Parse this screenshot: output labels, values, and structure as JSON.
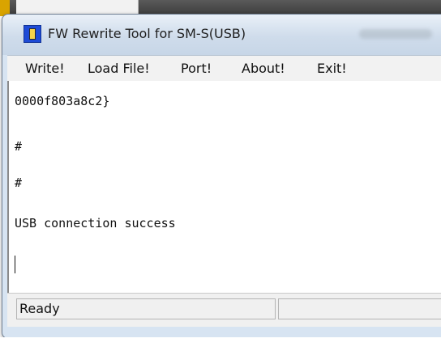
{
  "window": {
    "title": "FW Rewrite Tool for SM-S(USB)",
    "icon": "app-chip-icon"
  },
  "menu": {
    "items": [
      {
        "label": "Write!"
      },
      {
        "label": "Load File!"
      },
      {
        "label": "Port!"
      },
      {
        "label": "About!"
      },
      {
        "label": "Exit!"
      }
    ]
  },
  "log": {
    "lines": [
      "0000f803a8c2}",
      "#",
      "#",
      "USB connection success"
    ]
  },
  "status": {
    "text": "Ready"
  },
  "colors": {
    "title_bar": "#d7e4f2",
    "menu_bar": "#f2f2f2",
    "client_bg": "#ffffff",
    "status_bar": "#f0f0f0",
    "icon_blue": "#1e4bd6",
    "icon_yellow": "#f5d34b"
  }
}
